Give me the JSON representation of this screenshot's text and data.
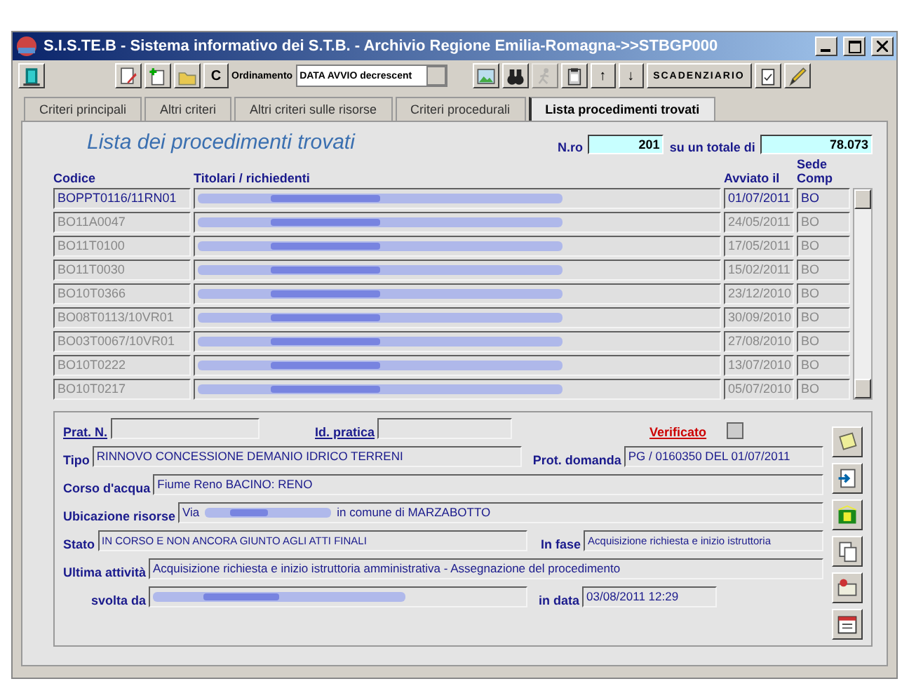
{
  "window": {
    "title": "S.I.S.TE.B - Sistema informativo dei S.T.B. - Archivio Regione Emilia-Romagna->>STBGP000"
  },
  "toolbar": [
    {
      "kind": "icon"
    },
    {
      "kind": "icon"
    },
    {
      "kind": "icon"
    },
    {
      "kind": "icon"
    },
    {
      "kind": "text",
      "label": "C"
    },
    {
      "kind": "sort",
      "label": "Ordinamento",
      "value": "DATA AVVIO decrescent"
    },
    {
      "kind": "icon"
    },
    {
      "kind": "icon"
    },
    {
      "kind": "icon",
      "disabled": true
    },
    {
      "kind": "icon"
    },
    {
      "kind": "text",
      "label": "↑"
    },
    {
      "kind": "text",
      "label": "↓"
    },
    {
      "kind": "text",
      "label": "SCADENZIARIO"
    },
    {
      "kind": "icon"
    },
    {
      "kind": "icon"
    }
  ],
  "tabs": [
    {
      "label": "Criteri principali",
      "selected": false
    },
    {
      "label": "Altri criteri",
      "selected": false
    },
    {
      "label": "Altri criteri sulle risorse",
      "selected": false
    },
    {
      "label": "Criteri procedurali",
      "selected": false
    },
    {
      "label": "Lista procedimenti trovati",
      "selected": true
    }
  ],
  "list": {
    "title": "Lista dei procedimenti trovati",
    "number_label": "N.ro",
    "number": "201",
    "total_label": "su un totale di",
    "total": "78.073",
    "columns": [
      "Codice",
      "Titolari / richiedenti",
      "Avviato il",
      "Sede Comp"
    ],
    "rows": [
      {
        "code": "BOPPT0116/11RN01",
        "date": "01/07/2011",
        "office": "BO",
        "selected": true
      },
      {
        "code": "BO11A0047",
        "date": "24/05/2011",
        "office": "BO",
        "selected": false
      },
      {
        "code": "BO11T0100",
        "date": "17/05/2011",
        "office": "BO",
        "selected": false
      },
      {
        "code": "BO11T0030",
        "date": "15/02/2011",
        "office": "BO",
        "selected": false
      },
      {
        "code": "BO10T0366",
        "date": "23/12/2010",
        "office": "BO",
        "selected": false
      },
      {
        "code": "BO08T0113/10VR01",
        "date": "30/09/2010",
        "office": "BO",
        "selected": false
      },
      {
        "code": "BO03T0067/10VR01",
        "date": "27/08/2010",
        "office": "BO",
        "selected": false
      },
      {
        "code": "BO10T0222",
        "date": "13/07/2010",
        "office": "BO",
        "selected": false
      },
      {
        "code": "BO10T0217",
        "date": "05/07/2010",
        "office": "BO",
        "selected": false
      }
    ]
  },
  "details": {
    "prat_label": "Prat. N.",
    "id_label": "Id. pratica",
    "verified_label": "Verificato",
    "verified": false,
    "tipo_label": "Tipo",
    "tipo": "RINNOVO CONCESSIONE DEMANIO IDRICO TERRENI",
    "prot_label": "Prot. domanda",
    "prot": "PG / 0160350 DEL 01/07/2011",
    "corso_label": "Corso d'acqua",
    "corso": "Fiume Reno BACINO: RENO",
    "ubic_label": "Ubicazione risorse",
    "ubic_start": "Via",
    "ubic_end": "in comune di MARZABOTTO",
    "stato_label": "Stato",
    "stato": "IN CORSO E NON ANCORA GIUNTO AGLI ATTI FINALI",
    "fase_label": "In fase",
    "fase": "Acquisizione richiesta e inizio istruttoria",
    "ultima_label": "Ultima attività",
    "ultima": "Acquisizione richiesta e inizio istruttoria amministrativa - Assegnazione del procedimento",
    "svolta_label": "svolta da",
    "data_label": "in data",
    "data": "03/08/2011 12:29"
  }
}
